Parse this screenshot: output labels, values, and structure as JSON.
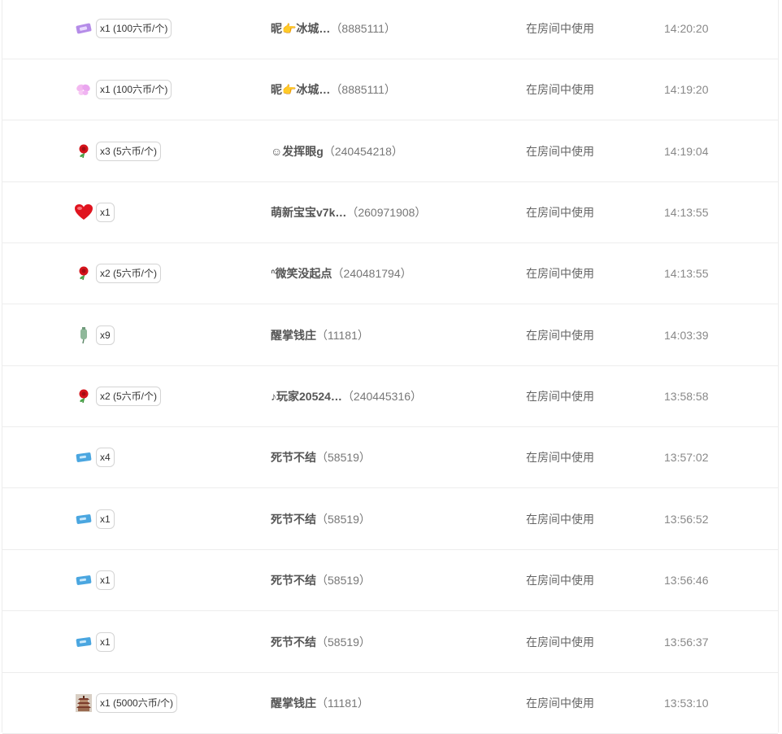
{
  "records": [
    {
      "gift_icon": "purple-ticket-icon",
      "qty": "x1 (100六币/个)",
      "user": "昵👉冰城…",
      "uid": "（8885111）",
      "action": "在房间中使用",
      "time": "14:20:20"
    },
    {
      "gift_icon": "pink-butterfly-icon",
      "qty": "x1 (100六币/个)",
      "user": "昵👉冰城…",
      "uid": "（8885111）",
      "action": "在房间中使用",
      "time": "14:19:20"
    },
    {
      "gift_icon": "rose-icon",
      "qty": "x3 (5六币/个)",
      "user": "☺发挥眼g",
      "uid": "（240454218）",
      "action": "在房间中使用",
      "time": "14:19:04"
    },
    {
      "gift_icon": "heart-icon",
      "qty": "x1",
      "user": "萌新宝宝v7k…",
      "uid": "（260971908）",
      "action": "在房间中使用",
      "time": "14:13:55"
    },
    {
      "gift_icon": "rose-icon",
      "qty": "x2 (5六币/个)",
      "user": "ᐢ微笑没起点",
      "uid": "（240481794）",
      "action": "在房间中使用",
      "time": "14:13:55"
    },
    {
      "gift_icon": "green-bottle-icon",
      "qty": "x9",
      "user": "醒掌钱庄",
      "uid": "（11181）",
      "action": "在房间中使用",
      "time": "14:03:39"
    },
    {
      "gift_icon": "rose-icon",
      "qty": "x2 (5六币/个)",
      "user": "♪玩家20524…",
      "uid": "（240445316）",
      "action": "在房间中使用",
      "time": "13:58:58"
    },
    {
      "gift_icon": "blue-ticket-icon",
      "qty": "x4",
      "user": "死节不结",
      "uid": "（58519）",
      "action": "在房间中使用",
      "time": "13:57:02"
    },
    {
      "gift_icon": "blue-ticket-icon",
      "qty": "x1",
      "user": "死节不结",
      "uid": "（58519）",
      "action": "在房间中使用",
      "time": "13:56:52"
    },
    {
      "gift_icon": "blue-ticket-icon",
      "qty": "x1",
      "user": "死节不结",
      "uid": "（58519）",
      "action": "在房间中使用",
      "time": "13:56:46"
    },
    {
      "gift_icon": "blue-ticket-icon",
      "qty": "x1",
      "user": "死节不结",
      "uid": "（58519）",
      "action": "在房间中使用",
      "time": "13:56:37"
    },
    {
      "gift_icon": "pagoda-icon",
      "qty": "x1 (5000六币/个)",
      "user": "醒掌钱庄",
      "uid": "（11181）",
      "action": "在房间中使用",
      "time": "13:53:10"
    }
  ]
}
